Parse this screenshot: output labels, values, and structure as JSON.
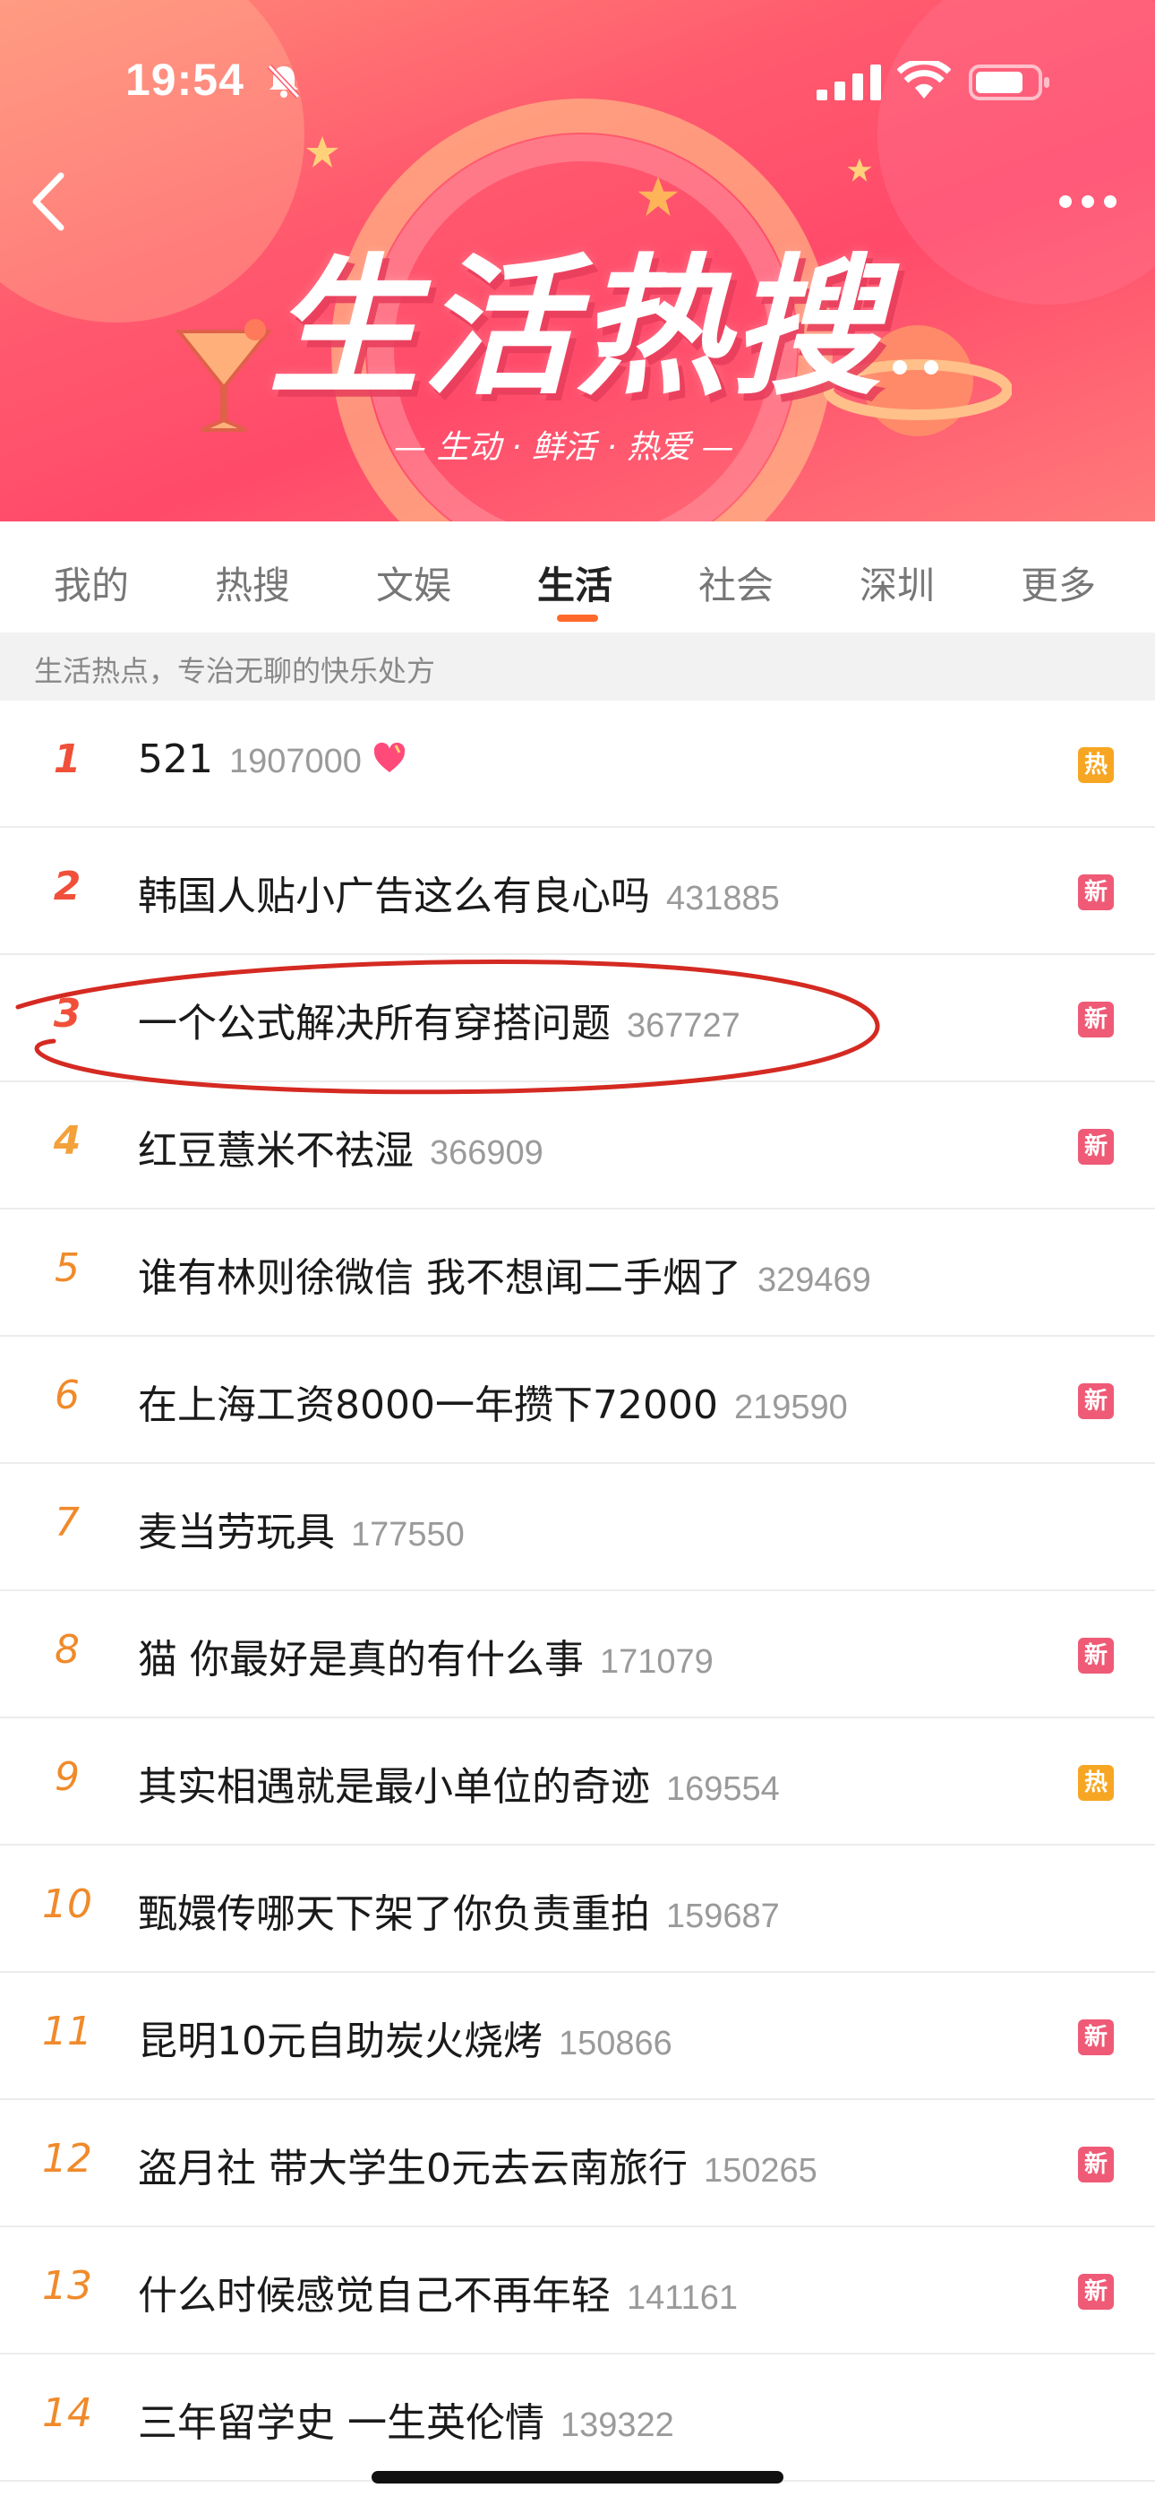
{
  "status_bar": {
    "time": "19:54"
  },
  "banner": {
    "title": "生活热搜",
    "subtitle": "— 生动 · 鲜活 · 热爱 —"
  },
  "tabs": [
    {
      "label": "我的",
      "active": false
    },
    {
      "label": "热搜",
      "active": false
    },
    {
      "label": "文娱",
      "active": false
    },
    {
      "label": "生活",
      "active": true
    },
    {
      "label": "社会",
      "active": false
    },
    {
      "label": "深圳",
      "active": false
    },
    {
      "label": "更多",
      "active": false
    }
  ],
  "hint": "生活热点，专治无聊的快乐处方",
  "colors": {
    "hot_badge": "#f7a623",
    "new_badge": "#ef5a76",
    "tab_underline": "#ff6a2a"
  },
  "items": [
    {
      "rank": "1",
      "title": "521",
      "count": "1907000",
      "badge": "热",
      "badge_type": "hot",
      "icon": "heart-emoji-icon"
    },
    {
      "rank": "2",
      "title": "韩国人贴小广告这么有良心吗",
      "count": "431885",
      "badge": "新",
      "badge_type": "new"
    },
    {
      "rank": "3",
      "title": "一个公式解决所有穿搭问题",
      "count": "367727",
      "badge": "新",
      "badge_type": "new"
    },
    {
      "rank": "4",
      "title": "红豆薏米不祛湿",
      "count": "366909",
      "badge": "新",
      "badge_type": "new"
    },
    {
      "rank": "5",
      "title": "谁有林则徐微信 我不想闻二手烟了",
      "count": "329469",
      "badge": "",
      "badge_type": ""
    },
    {
      "rank": "6",
      "title": "在上海工资8000一年攒下72000",
      "count": "219590",
      "badge": "新",
      "badge_type": "new"
    },
    {
      "rank": "7",
      "title": "麦当劳玩具",
      "count": "177550",
      "badge": "",
      "badge_type": ""
    },
    {
      "rank": "8",
      "title": "猫 你最好是真的有什么事",
      "count": "171079",
      "badge": "新",
      "badge_type": "new"
    },
    {
      "rank": "9",
      "title": "其实相遇就是最小单位的奇迹",
      "count": "169554",
      "badge": "热",
      "badge_type": "hot"
    },
    {
      "rank": "10",
      "title": "甄嬛传哪天下架了你负责重拍",
      "count": "159687",
      "badge": "",
      "badge_type": ""
    },
    {
      "rank": "11",
      "title": "昆明10元自助炭火烧烤",
      "count": "150866",
      "badge": "新",
      "badge_type": "new"
    },
    {
      "rank": "12",
      "title": "盗月社 带大学生0元去云南旅行",
      "count": "150265",
      "badge": "新",
      "badge_type": "new"
    },
    {
      "rank": "13",
      "title": "什么时候感觉自己不再年轻",
      "count": "141161",
      "badge": "新",
      "badge_type": "new"
    },
    {
      "rank": "14",
      "title": "三年留学史 一生英伦情",
      "count": "139322",
      "badge": "",
      "badge_type": ""
    }
  ]
}
